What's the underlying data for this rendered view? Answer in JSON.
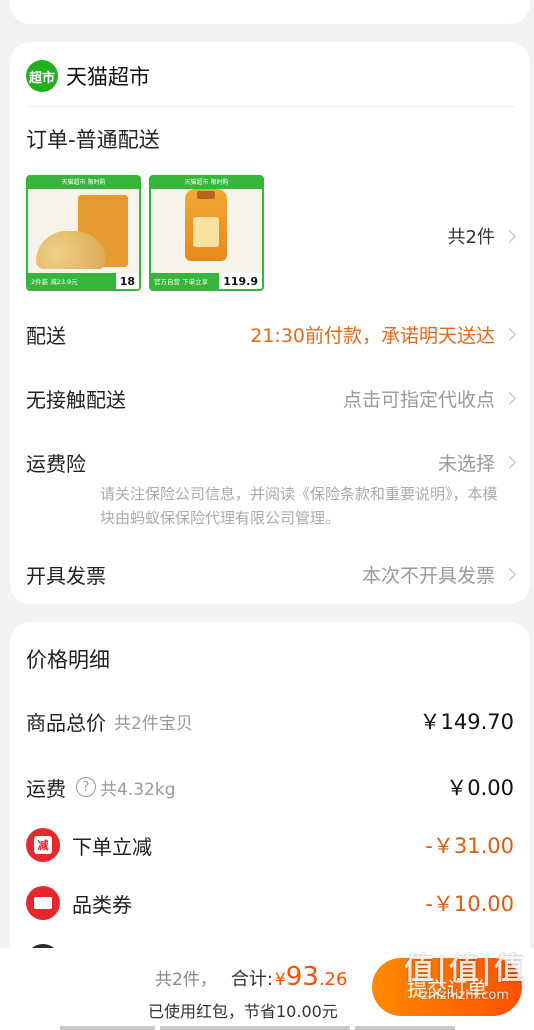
{
  "store": {
    "logo_text": "超市",
    "name": "天猫超市"
  },
  "order": {
    "title": "订单-普通配送",
    "products": [
      {
        "top_banner": "天猫超市 限时购",
        "bottom_tag": "2件装 减23.9元",
        "price": "18",
        "icon": "nuts-product-image"
      },
      {
        "top_banner": "天猫超市 限时购",
        "bottom_tag": "官方自营 下单立享",
        "price": "119.9",
        "icon": "oil-product-image"
      }
    ],
    "product_count": "共2件",
    "delivery_label": "配送",
    "delivery_value": "21:30前付款，承诺明天送达",
    "contactless_label": "无接触配送",
    "contactless_value": "点击可指定代收点",
    "insurance_label": "运费险",
    "insurance_value": "未选择",
    "insurance_note": "请关注保险公司信息，并阅读《保险条款和重要说明》，本模块由蚂蚁保保险代理有限公司管理。",
    "invoice_label": "开具发票",
    "invoice_value": "本次不开具发票"
  },
  "price": {
    "title": "价格明细",
    "goods_total_label": "商品总价",
    "goods_total_sub": "共2件宝贝",
    "goods_total_value": "￥149.70",
    "shipping_label": "运费",
    "shipping_help_icon": "?",
    "shipping_weight": "共4.32kg",
    "shipping_value": "￥0.00",
    "discount_label": "下单立减",
    "discount_icon_text": "减",
    "discount_value": "-￥31.00",
    "coupon_label": "品类券",
    "coupon_value": "-￥10.00"
  },
  "bottom": {
    "count": "共2件，",
    "total_label": "合计:",
    "currency": "¥",
    "total_int": "93",
    "total_dec": ".26",
    "saved_text": "已使用红包，节省10.00元",
    "submit_label": "提交订单"
  },
  "watermark": {
    "big": "值|值|值",
    "small": "zhizhizhi.com"
  },
  "colors": {
    "accent": "#ff5000",
    "green": "#1fb11f",
    "delivery_orange": "#e06a1b"
  }
}
